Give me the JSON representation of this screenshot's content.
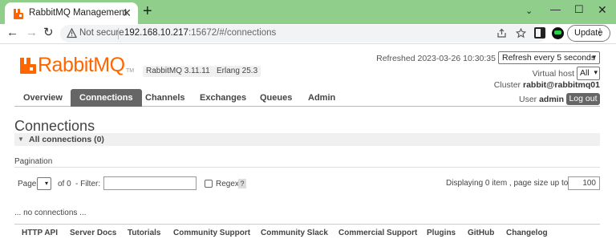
{
  "browser": {
    "tab_title": "RabbitMQ Management",
    "tab_close": "✕",
    "new_tab": "+",
    "nav": {
      "back": "←",
      "forward": "→",
      "reload": "↻"
    },
    "security_label": "Not secure",
    "url_host": "192.168.10.217",
    "url_path": ":15672/#/connections",
    "update_label": "Update",
    "window_controls": {
      "chevron": "⌄",
      "minimize": "—",
      "maximize": "☐",
      "close": "✕"
    }
  },
  "header": {
    "logo_text": "RabbitMQ",
    "logo_tm": "TM",
    "rabbitmq_version": "RabbitMQ 3.11.11",
    "erlang_version": "Erlang 25.3",
    "refreshed": "Refreshed 2023-03-26 10:30:35",
    "refresh_option": "Refresh every 5 seconds",
    "vhost_label": "Virtual host",
    "vhost_value": "All",
    "cluster_label": "Cluster",
    "cluster_value": "rabbit@rabbitmq01",
    "user_label": "User",
    "user_value": "admin",
    "logout_label": "Log out"
  },
  "nav": {
    "items": [
      "Overview",
      "Connections",
      "Channels",
      "Exchanges",
      "Queues",
      "Admin"
    ],
    "active": "Connections"
  },
  "main": {
    "title": "Connections",
    "section_title": "All connections (0)",
    "pagination_label": "Pagination",
    "page_label": "Page",
    "of_label": "of 0",
    "filter_label": "- Filter:",
    "regex_label": "Regex",
    "help_label": "?",
    "display_text": "Displaying 0 item , page size up to:",
    "page_size": "100",
    "empty_message": "... no connections ..."
  },
  "footer": {
    "links": [
      "HTTP API",
      "Server Docs",
      "Tutorials",
      "Community Support",
      "Community Slack",
      "Commercial Support",
      "Plugins",
      "GitHub",
      "Changelog"
    ]
  },
  "colors": {
    "chrome_green": "#8fcf8b",
    "rabbit_orange": "#ff6600",
    "active_tab": "#666666"
  }
}
